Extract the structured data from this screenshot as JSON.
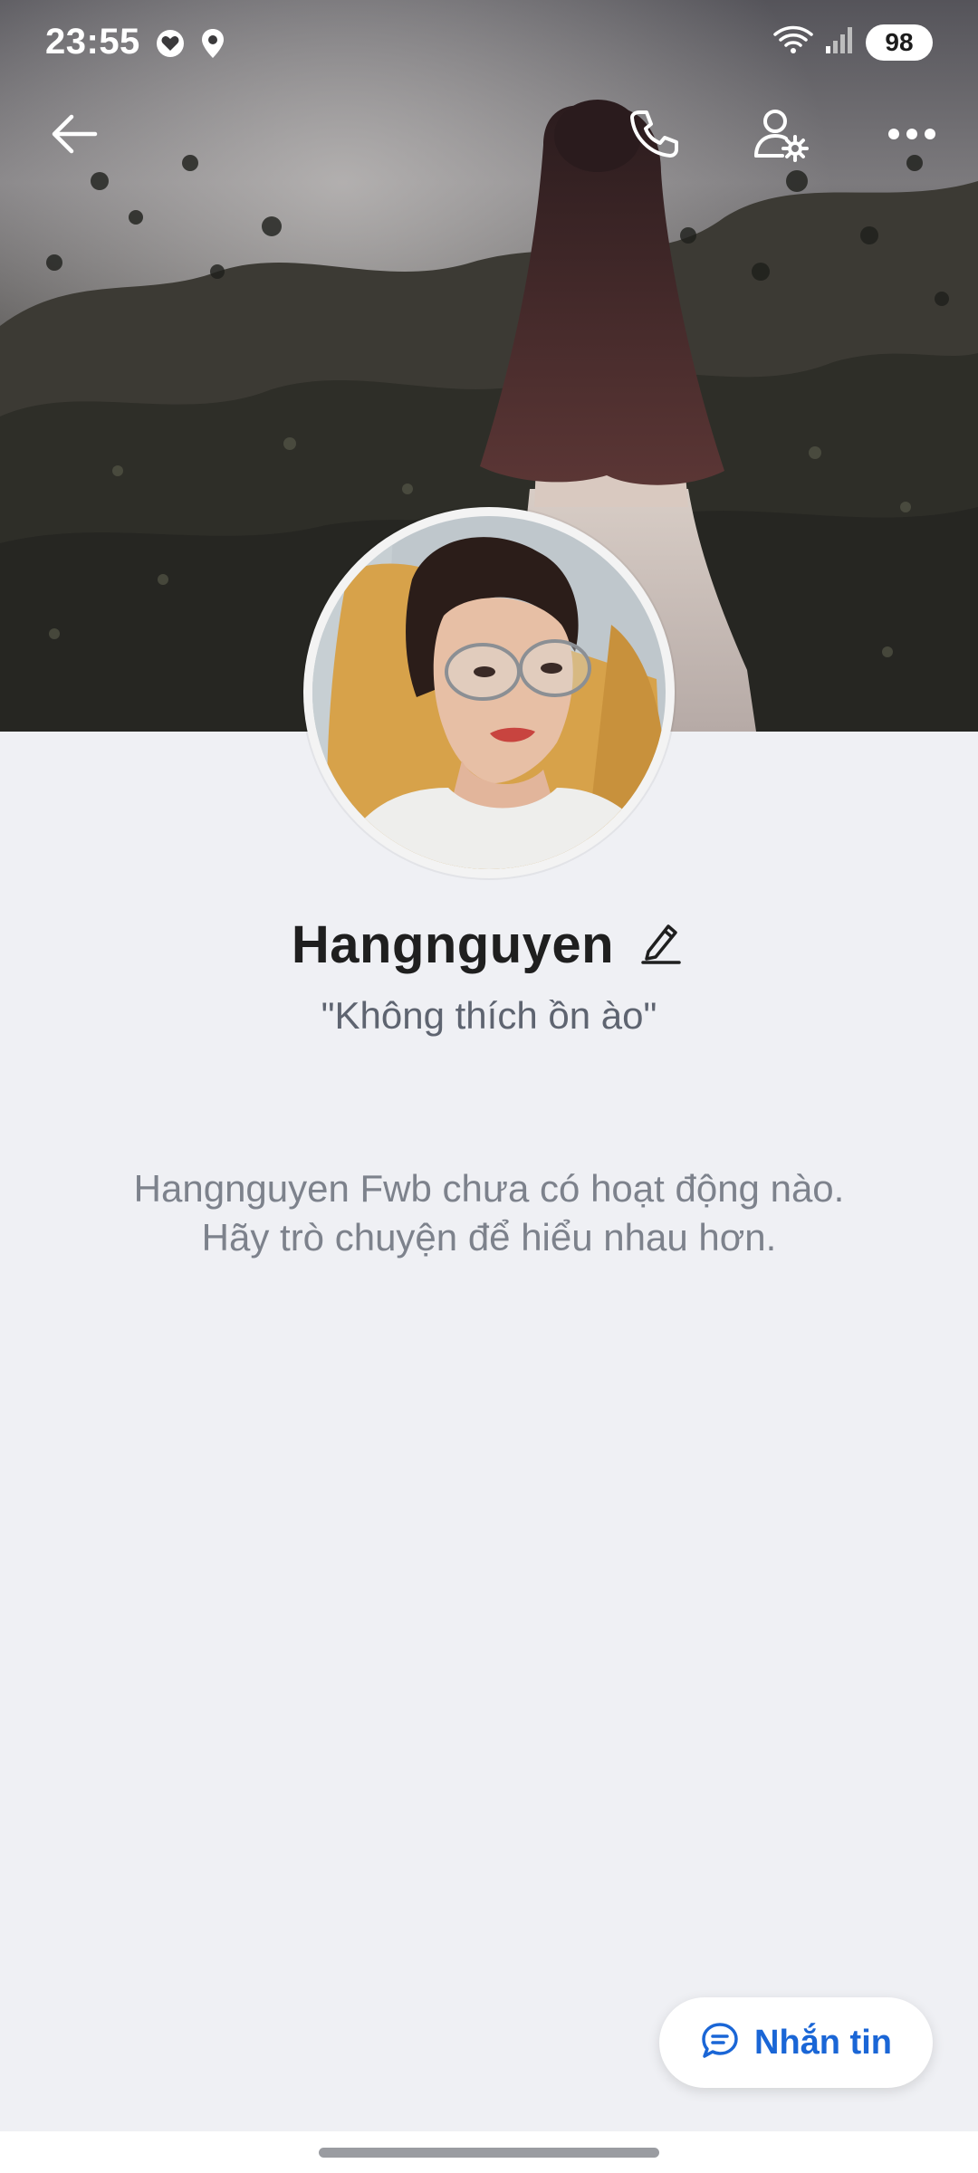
{
  "status_bar": {
    "time": "23:55",
    "left_icons": [
      "heart-notification-icon",
      "location-pin-icon"
    ],
    "right_icons": [
      "wifi-icon",
      "signal-icon"
    ],
    "battery": "98"
  },
  "toolbar": {
    "back_icon": "back-arrow-icon",
    "call_icon": "phone-icon",
    "settings_icon": "user-settings-icon",
    "more_icon": "more-dots-icon"
  },
  "profile": {
    "name": "Hangnguyen",
    "status": "\"Không thích ồn ào\"",
    "edit_icon": "pencil-icon"
  },
  "empty_state": {
    "line1": "Hangnguyen Fwb chưa có hoạt động nào.",
    "line2": "Hãy trò chuyện để hiểu nhau hơn."
  },
  "message_button": {
    "label": "Nhắn tin",
    "icon": "chat-bubble-icon"
  },
  "colors": {
    "accent": "#1a66d6",
    "background": "#eff0f4",
    "text_primary": "#1f1f1f",
    "text_secondary": "#7d828c"
  }
}
